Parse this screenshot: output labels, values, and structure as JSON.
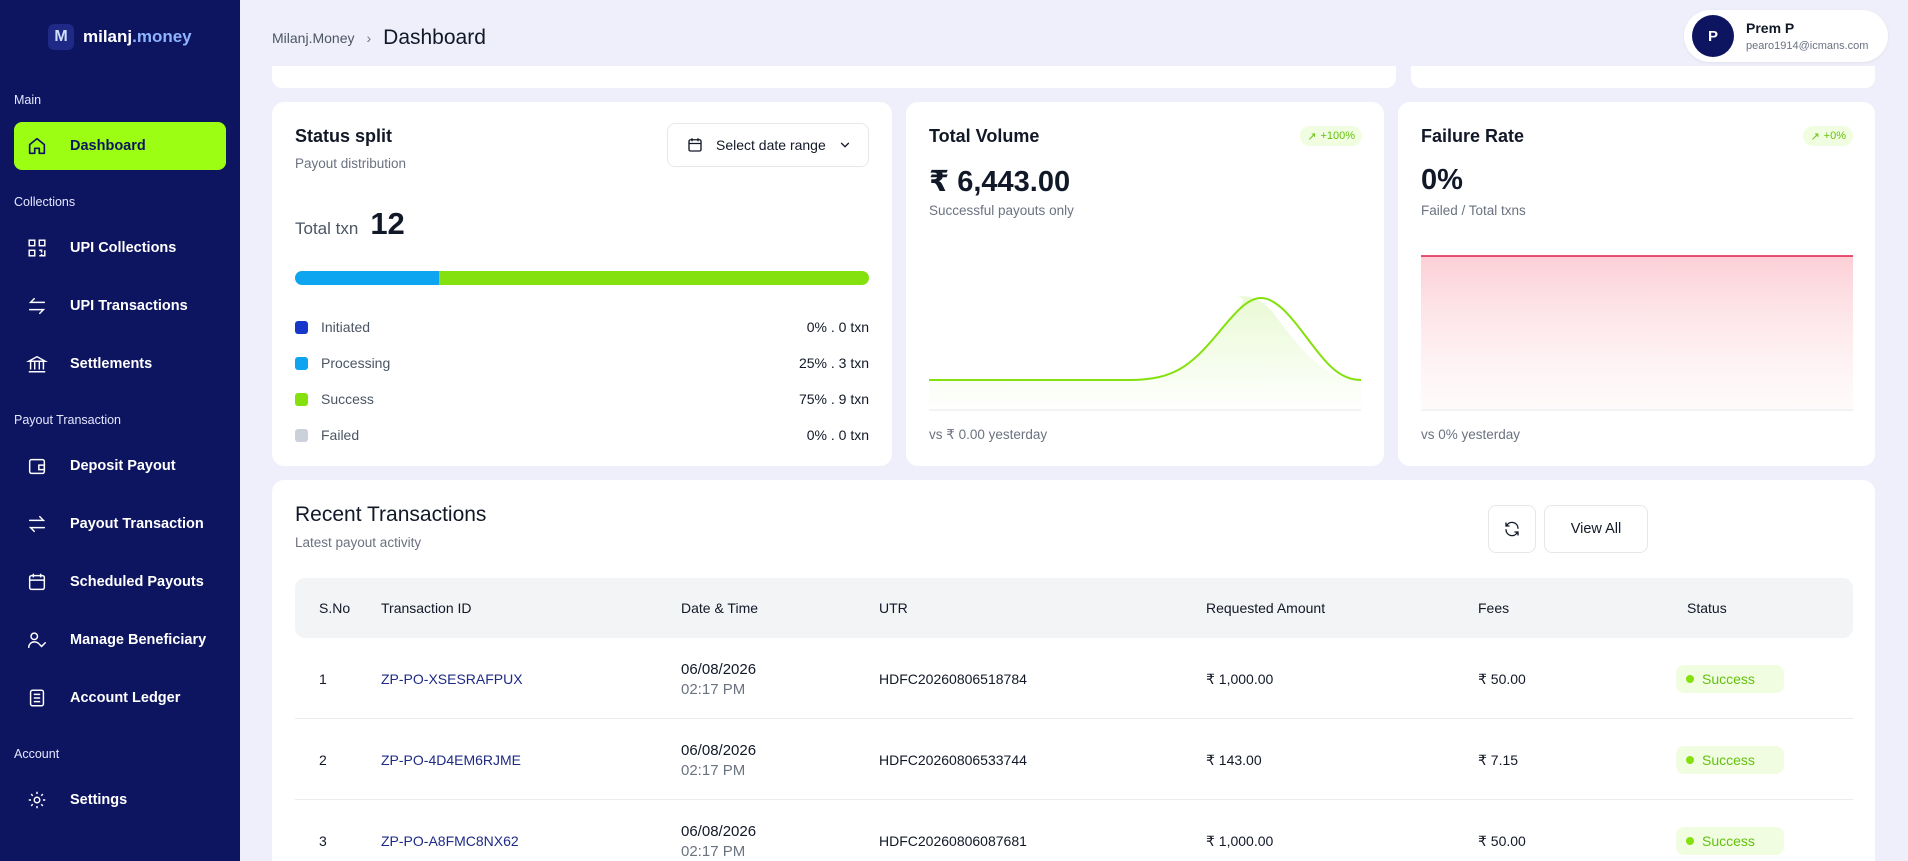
{
  "brand": {
    "name_main": "milanj",
    "name_suffix": ".money"
  },
  "sidebar": {
    "sections": [
      {
        "label": "Main"
      },
      {
        "label": "Collections"
      },
      {
        "label": "Payout Transaction"
      },
      {
        "label": "Account"
      }
    ],
    "items": [
      {
        "label": "Dashboard",
        "icon": "home-icon"
      },
      {
        "label": "UPI Collections",
        "icon": "qr-icon"
      },
      {
        "label": "UPI Transactions",
        "icon": "swap-icon"
      },
      {
        "label": "Settlements",
        "icon": "bank-icon"
      },
      {
        "label": "Deposit Payout",
        "icon": "wallet-icon"
      },
      {
        "label": "Payout Transaction",
        "icon": "arrows-icon"
      },
      {
        "label": "Scheduled Payouts",
        "icon": "calendar-icon"
      },
      {
        "label": "Manage Beneficiary",
        "icon": "user-check-icon"
      },
      {
        "label": "Account Ledger",
        "icon": "ledger-icon"
      },
      {
        "label": "Settings",
        "icon": "gear-icon"
      }
    ]
  },
  "header": {
    "breadcrumb_root": "Milanj.Money",
    "breadcrumb_sep": "›",
    "page_title": "Dashboard"
  },
  "user": {
    "initial": "P",
    "name": "Prem P",
    "email": "pearo1914@icmans.com"
  },
  "status_split": {
    "title": "Status split",
    "subtitle": "Payout distribution",
    "date_button": "Select date range",
    "total_label": "Total txn",
    "total_value": "12",
    "legend": [
      {
        "name": "Initiated",
        "stat": "0% . 0 txn",
        "color": "#1637c9",
        "fraction": 0
      },
      {
        "name": "Processing",
        "stat": "25% . 3 txn",
        "color": "#0ea5f0",
        "fraction": 0.25
      },
      {
        "name": "Success",
        "stat": "75% . 9 txn",
        "color": "#84e10e",
        "fraction": 0.75
      },
      {
        "name": "Failed",
        "stat": "0% . 0 txn",
        "color": "#cbd0da",
        "fraction": 0
      }
    ]
  },
  "total_volume": {
    "title": "Total Volume",
    "badge": "+100%",
    "value": "₹ 6,443.00",
    "subtitle": "Successful payouts only",
    "footnote": "vs ₹ 0.00 yesterday",
    "color": "#84e10e"
  },
  "failure_rate": {
    "title": "Failure Rate",
    "badge": "+0%",
    "value": "0%",
    "subtitle": "Failed / Total txns",
    "footnote": "vs 0% yesterday",
    "color": "#e11d48"
  },
  "transactions": {
    "title": "Recent Transactions",
    "subtitle": "Latest payout activity",
    "view_all": "View All",
    "columns": [
      "S.No",
      "Transaction ID",
      "Date & Time",
      "UTR",
      "Requested Amount",
      "Fees",
      "Status"
    ],
    "rows": [
      {
        "sno": "1",
        "id": "ZP-PO-XSESRAFPUX",
        "date": "06/08/2026",
        "time": "02:17 PM",
        "utr": "HDFC20260806518784",
        "amount": "₹ 1,000.00",
        "fees": "₹ 50.00",
        "status": "Success"
      },
      {
        "sno": "2",
        "id": "ZP-PO-4D4EM6RJME",
        "date": "06/08/2026",
        "time": "02:17 PM",
        "utr": "HDFC20260806533744",
        "amount": "₹ 143.00",
        "fees": "₹ 7.15",
        "status": "Success"
      },
      {
        "sno": "3",
        "id": "ZP-PO-A8FMC8NX62",
        "date": "06/08/2026",
        "time": "02:17 PM",
        "utr": "HDFC20260806087681",
        "amount": "₹ 1,000.00",
        "fees": "₹ 50.00",
        "status": "Success"
      }
    ]
  }
}
